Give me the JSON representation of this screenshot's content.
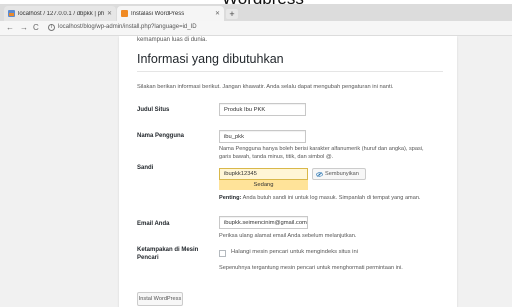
{
  "overlay_caption": "Wordpress",
  "browser": {
    "tabs": [
      {
        "label": "localhost / 127.0.0.1 / dbpkk | ph",
        "active": false
      },
      {
        "label": "Instalasi WordPress",
        "active": true
      }
    ],
    "new_tab": "+",
    "nav": {
      "back": "←",
      "forward": "→",
      "reload": "C"
    },
    "url": "localhost/blog/wp-admin/install.php?language=id_ID"
  },
  "page": {
    "intro_tail": "kemampuan luas di dunia.",
    "section_title": "Informasi yang dibutuhkan",
    "section_desc": "Silakan berikan informasi berikut. Jangan khawatir. Anda selalu dapat mengubah pengaturan ini nanti.",
    "fields": {
      "site_title": {
        "label": "Judul Situs",
        "value": "Produk Ibu PKK"
      },
      "username": {
        "label": "Nama Pengguna",
        "value": "ibu_pkk",
        "hint_line1": "Nama Pengguna hanya boleh berisi karakter alfanumerik (huruf dan angka), spasi,",
        "hint_line2": "garis bawah, tanda minus, titik, dan simbol @."
      },
      "password": {
        "label": "Sandi",
        "value": "ibupkk12345",
        "strength": "Sedang",
        "hide_button": "Sembunyikan",
        "note_bold": "Penting:",
        "note_text": " Anda butuh sandi ini untuk log masuk. Simpanlah di tempat yang aman."
      },
      "email": {
        "label": "Email Anda",
        "value": "ibupkk.seimencinim@gmail.com",
        "hint": "Periksa ulang alamat email Anda sebelum melanjutkan."
      },
      "visibility": {
        "label_line1": "Ketampakan di Mesin",
        "label_line2": "Pencari",
        "checkbox_label": "Halangi mesin pencari untuk mengindeks situs ini",
        "checked": false,
        "hint": "Sepenuhnya tergantung mesin pencari untuk menghormati permintaan ini."
      }
    },
    "install_button": "Instal WordPress"
  },
  "colors": {
    "panel_bg": "#ffffff",
    "page_bg": "#f1f1f1",
    "password_bg": "#fff6d6",
    "strength_bg": "#ffe399",
    "tab_wp_icon": "#f08a24"
  }
}
